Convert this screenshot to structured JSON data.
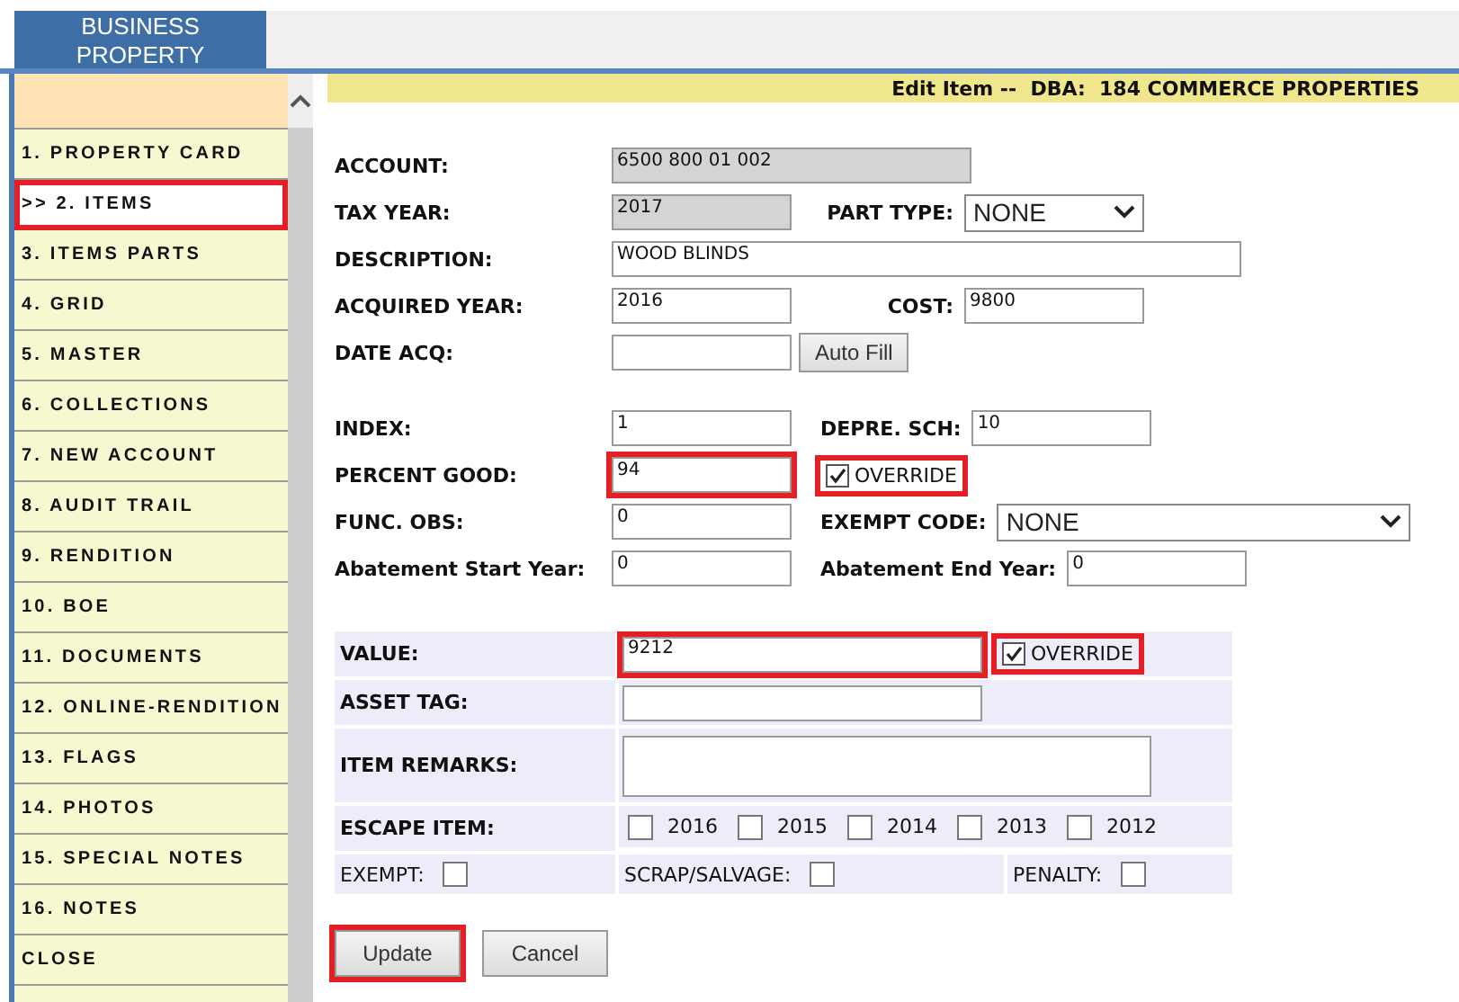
{
  "header": {
    "title": "BUSINESS PROPERTY"
  },
  "sidebar": {
    "items": [
      {
        "label": "1. PROPERTY CARD",
        "selected": false,
        "highlighted": false
      },
      {
        "label": ">> 2. ITEMS",
        "selected": true,
        "highlighted": true
      },
      {
        "label": "3. ITEMS PARTS",
        "selected": false,
        "highlighted": false
      },
      {
        "label": "4. GRID",
        "selected": false,
        "highlighted": false
      },
      {
        "label": "5. MASTER",
        "selected": false,
        "highlighted": false
      },
      {
        "label": "6. COLLECTIONS",
        "selected": false,
        "highlighted": false
      },
      {
        "label": "7. NEW ACCOUNT",
        "selected": false,
        "highlighted": false
      },
      {
        "label": "8. AUDIT TRAIL",
        "selected": false,
        "highlighted": false
      },
      {
        "label": "9. RENDITION",
        "selected": false,
        "highlighted": false
      },
      {
        "label": "10. BOE",
        "selected": false,
        "highlighted": false
      },
      {
        "label": "11. DOCUMENTS",
        "selected": false,
        "highlighted": false
      },
      {
        "label": "12. ONLINE-RENDITION",
        "selected": false,
        "highlighted": false
      },
      {
        "label": "13. FLAGS",
        "selected": false,
        "highlighted": false
      },
      {
        "label": "14. PHOTOS",
        "selected": false,
        "highlighted": false
      },
      {
        "label": "15. SPECIAL NOTES",
        "selected": false,
        "highlighted": false
      },
      {
        "label": "16. NOTES",
        "selected": false,
        "highlighted": false
      },
      {
        "label": "CLOSE",
        "selected": false,
        "highlighted": false
      }
    ]
  },
  "form": {
    "title": "Edit Item --  DBA:  184 COMMERCE PROPERTIES",
    "section_1": [
      {
        "label": "ACCOUNT:",
        "field": {
          "kind": "text",
          "value": "6500 800 01 002",
          "disabled": true,
          "highlighted": false
        }
      },
      {
        "label": "TAX YEAR:",
        "field": {
          "kind": "text",
          "value": "2017",
          "disabled": true,
          "highlighted": false
        },
        "second": {
          "label": "PART TYPE:",
          "field": {
            "kind": "select",
            "value": "NONE",
            "highlighted": false
          }
        }
      },
      {
        "label": "DESCRIPTION:",
        "field": {
          "kind": "text",
          "value": "WOOD BLINDS",
          "disabled": false,
          "highlighted": false
        }
      },
      {
        "label": "ACQUIRED YEAR:",
        "field": {
          "kind": "text",
          "value": "2016",
          "disabled": false,
          "highlighted": false
        },
        "second": {
          "label": "COST:",
          "field": {
            "kind": "text",
            "value": "9800",
            "disabled": false,
            "highlighted": false
          }
        }
      },
      {
        "label": "DATE ACQ:",
        "field": {
          "kind": "text",
          "disabled": false,
          "highlighted": false
        },
        "second": {
          "field": {
            "kind": "button",
            "label": "Auto Fill",
            "highlighted": false
          }
        }
      }
    ],
    "section_2": [
      {
        "label": "INDEX:",
        "field": {
          "kind": "text",
          "value": "1",
          "disabled": false,
          "highlighted": false
        },
        "second": {
          "label": "DEPRE. SCH:",
          "field": {
            "kind": "text",
            "value": "10",
            "disabled": false,
            "highlighted": false
          }
        }
      },
      {
        "label": "PERCENT GOOD:",
        "field": {
          "kind": "text",
          "value": "94",
          "disabled": false,
          "highlighted": true
        },
        "second": {
          "field": {
            "kind": "checkbox",
            "label": "OVERRIDE",
            "checked": true,
            "highlighted": true
          }
        }
      },
      {
        "label": "FUNC. OBS:",
        "field": {
          "kind": "text",
          "value": "0",
          "disabled": false,
          "highlighted": false
        },
        "second": {
          "label": "EXEMPT CODE:",
          "field": {
            "kind": "select",
            "value": "NONE",
            "highlighted": false
          }
        }
      },
      {
        "label": "Abatement Start Year:",
        "field": {
          "kind": "text",
          "value": "0",
          "disabled": false,
          "highlighted": false
        },
        "second": {
          "label": "Abatement End Year:",
          "field": {
            "kind": "text",
            "value": "0",
            "disabled": false,
            "highlighted": false
          }
        }
      }
    ]
  },
  "details": {
    "rows": [
      {
        "kind": "field",
        "label": "VALUE:",
        "field": {
          "kind": "text",
          "value": "9212",
          "highlighted": true
        },
        "extra": {
          "kind": "checkbox",
          "label": "OVERRIDE",
          "checked": true,
          "highlighted": true
        }
      },
      {
        "kind": "field",
        "label": "ASSET TAG:",
        "field": {
          "kind": "text",
          "highlighted": false
        }
      },
      {
        "kind": "field",
        "label": "ITEM REMARKS:",
        "field": {
          "kind": "textarea",
          "highlighted": false
        }
      },
      {
        "kind": "checks",
        "label": "ESCAPE ITEM:",
        "options": [
          {
            "label": "2016",
            "checked": false
          },
          {
            "label": "2015",
            "checked": false
          },
          {
            "label": "2014",
            "checked": false
          },
          {
            "label": "2013",
            "checked": false
          },
          {
            "label": "2012",
            "checked": false
          }
        ]
      },
      {
        "kind": "flags",
        "flags": [
          {
            "label": "EXEMPT:",
            "checked": false
          },
          {
            "label": "SCRAP/SALVAGE:",
            "checked": false
          },
          {
            "label": "PENALTY:",
            "checked": false
          }
        ]
      }
    ]
  },
  "buttons": [
    {
      "label": "Update",
      "highlighted": true
    },
    {
      "label": "Cancel",
      "highlighted": false
    }
  ]
}
